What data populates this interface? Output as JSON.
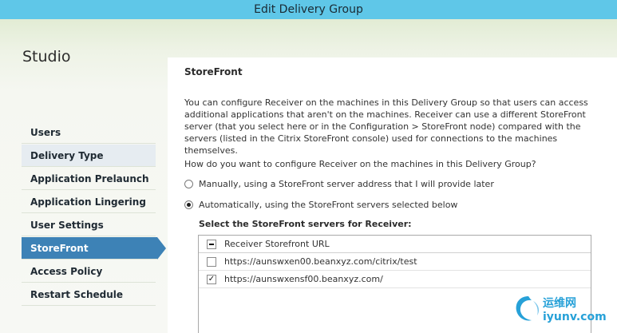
{
  "window": {
    "title": "Edit Delivery Group"
  },
  "sidebar": {
    "title": "Studio",
    "items": [
      {
        "label": "Users"
      },
      {
        "label": "Delivery Type"
      },
      {
        "label": "Application Prelaunch"
      },
      {
        "label": "Application Lingering"
      },
      {
        "label": "User Settings"
      },
      {
        "label": "StoreFront"
      },
      {
        "label": "Access Policy"
      },
      {
        "label": "Restart Schedule"
      }
    ],
    "active_item": "StoreFront"
  },
  "main": {
    "heading": "StoreFront",
    "description": "You can configure Receiver on the machines in this Delivery Group so that users can access additional applications that aren't on the machines. Receiver can use a different StoreFront server (that you select here or in the Configuration > StoreFront node) compared with the servers (listed in the Citrix StoreFront console) used for connections to the machines themselves.",
    "question": "How do you want to configure Receiver on the machines in this Delivery Group?",
    "options": [
      {
        "label": "Manually, using a StoreFront server address that I will provide later",
        "selected": false
      },
      {
        "label": "Automatically, using the StoreFront servers selected below",
        "selected": true
      }
    ],
    "select_label": "Select the StoreFront servers for Receiver:",
    "table": {
      "header": "Receiver Storefront URL",
      "rows": [
        {
          "url": "https://aunswxen00.beanxyz.com/citrix/test",
          "checked": false
        },
        {
          "url": "https://aunswxensf00.beanxyz.com/",
          "checked": true
        }
      ]
    }
  },
  "watermark": {
    "line1": "运维网",
    "line2": "iyunv.com"
  },
  "colors": {
    "titlebar": "#5fc7e8",
    "active_nav": "#3d82b6",
    "watermark": "#27a1d8"
  }
}
